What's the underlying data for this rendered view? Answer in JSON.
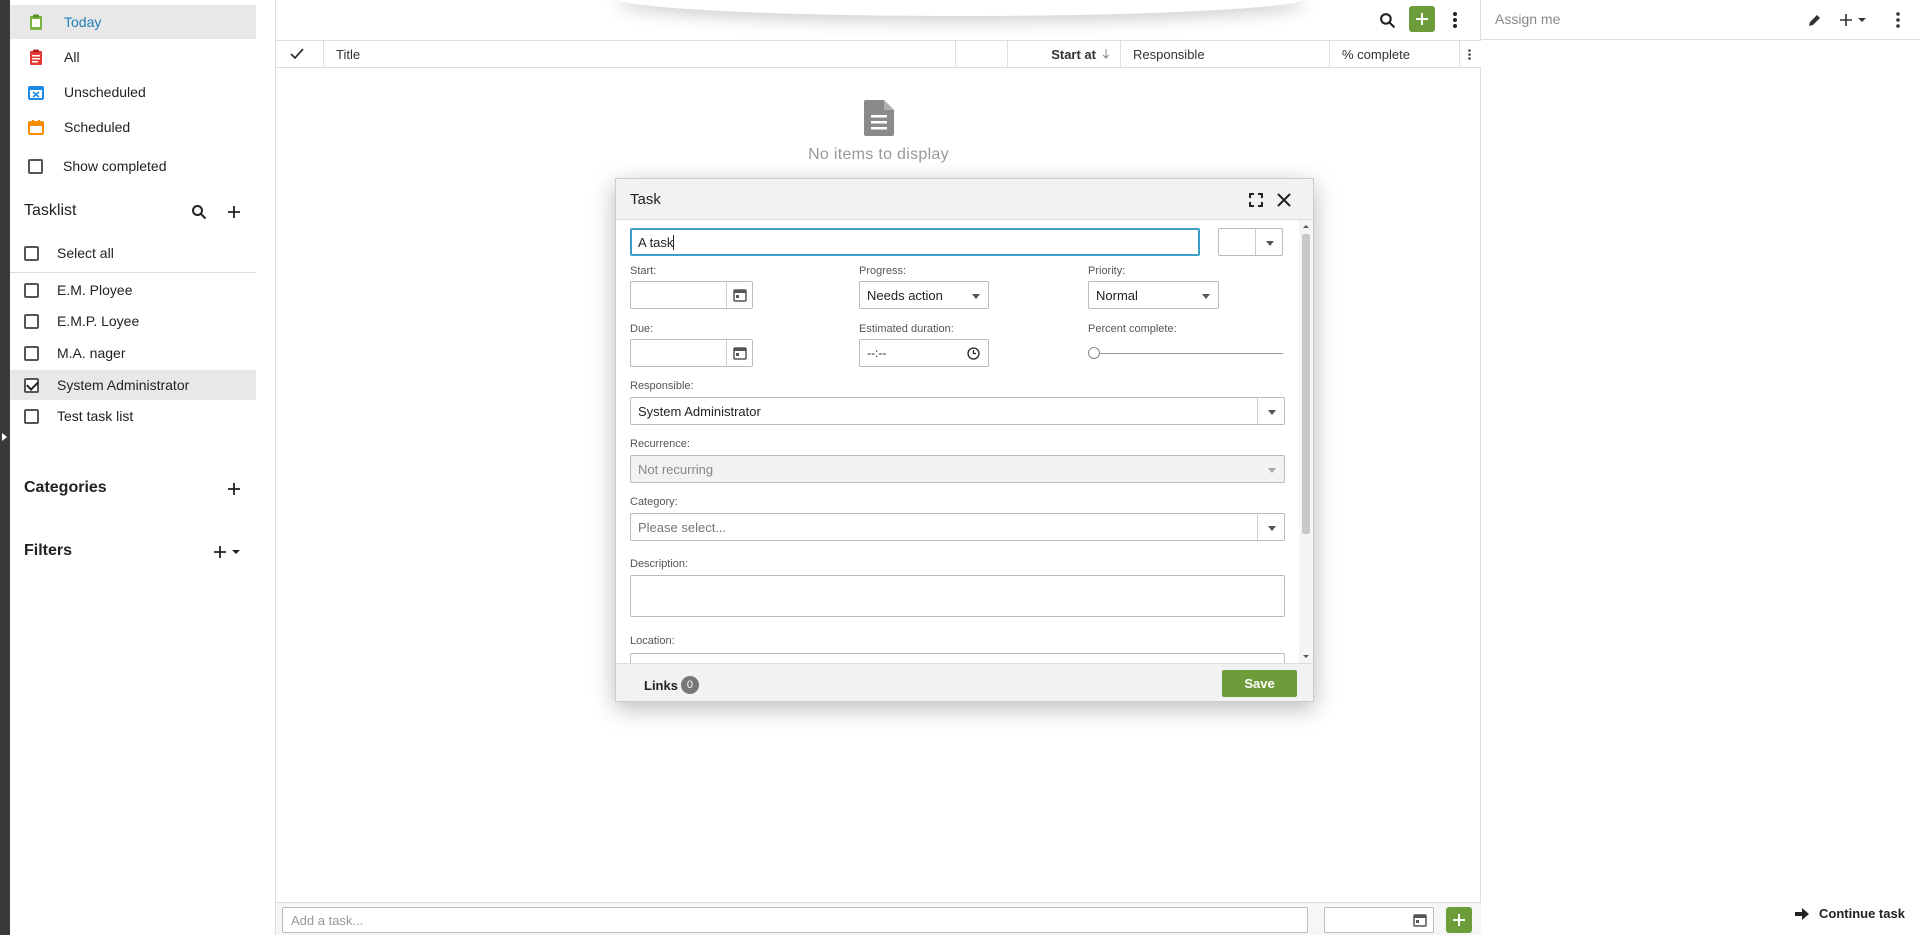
{
  "sidebar": {
    "nav": [
      {
        "label": "Today",
        "icon": "clipboard-check-icon",
        "color": "#7cb342",
        "active": true
      },
      {
        "label": "All",
        "icon": "clipboard-list-icon",
        "color": "#e53935"
      },
      {
        "label": "Unscheduled",
        "icon": "calendar-x-icon",
        "color": "#1e88e5"
      },
      {
        "label": "Scheduled",
        "icon": "calendar-icon",
        "color": "#fb8c00"
      }
    ],
    "show_completed": "Show completed",
    "tasklist_title": "Tasklist",
    "select_all": "Select all",
    "tasklists": [
      {
        "label": "E.M. Ployee",
        "checked": false
      },
      {
        "label": "E.M.P. Loyee",
        "checked": false
      },
      {
        "label": "M.A. nager",
        "checked": false
      },
      {
        "label": "System Administrator",
        "checked": true
      },
      {
        "label": "Test task list",
        "checked": false
      }
    ],
    "categories_title": "Categories",
    "filters_title": "Filters"
  },
  "main": {
    "columns": {
      "title": "Title",
      "start_at": "Start at",
      "responsible": "Responsible",
      "percent_complete": "% complete"
    },
    "empty_message": "No items to display",
    "add_task_placeholder": "Add a task..."
  },
  "right_panel": {
    "title": "Assign me",
    "continue_task": "Continue task"
  },
  "dialog": {
    "title": "Task",
    "task_title_value": "A task",
    "start_label": "Start:",
    "progress_label": "Progress:",
    "progress_value": "Needs action",
    "priority_label": "Priority:",
    "priority_value": "Normal",
    "due_label": "Due:",
    "estimated_label": "Estimated duration:",
    "estimated_value": "--:--",
    "percent_label": "Percent complete:",
    "percent_value": 0,
    "responsible_label": "Responsible:",
    "responsible_value": "System Administrator",
    "recurrence_label": "Recurrence:",
    "recurrence_value": "Not recurring",
    "category_label": "Category:",
    "category_placeholder": "Please select...",
    "description_label": "Description:",
    "location_label": "Location:",
    "links_label": "Links",
    "links_count": "0",
    "save_label": "Save"
  },
  "colors": {
    "accent_green": "#6d9c3a",
    "focus_blue": "#3aa0c8"
  }
}
